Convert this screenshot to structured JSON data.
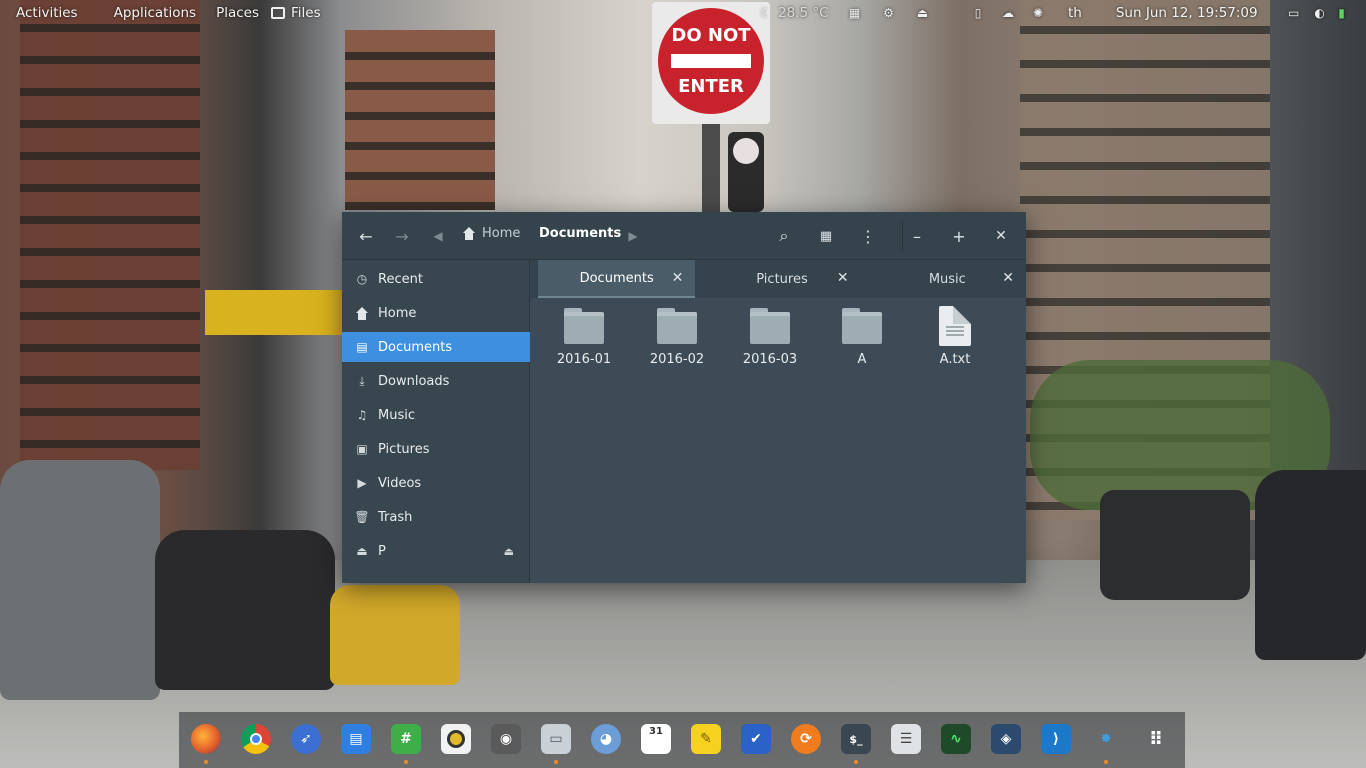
{
  "top_panel": {
    "activities": "Activities",
    "applications": "Applications",
    "places": "Places",
    "files": "Files",
    "weather": "28.5 °C",
    "lang": "th",
    "datetime": "Sun Jun 12, 19:57:09"
  },
  "wallpaper": {
    "sign_top": "DO NOT",
    "sign_bottom": "ENTER"
  },
  "window": {
    "breadcrumb_home": "Home",
    "breadcrumb_current": "Documents",
    "minimize": "–",
    "maximize": "+",
    "close": "✕"
  },
  "sidebar": {
    "items": [
      {
        "label": "Recent",
        "icon": "clock-icon"
      },
      {
        "label": "Home",
        "icon": "home-icon"
      },
      {
        "label": "Documents",
        "icon": "document-icon"
      },
      {
        "label": "Downloads",
        "icon": "download-icon"
      },
      {
        "label": "Music",
        "icon": "music-icon"
      },
      {
        "label": "Pictures",
        "icon": "picture-icon"
      },
      {
        "label": "Videos",
        "icon": "video-icon"
      },
      {
        "label": "Trash",
        "icon": "trash-icon"
      },
      {
        "label": "P",
        "icon": "drive-icon"
      }
    ],
    "selected": "Documents"
  },
  "tabs": [
    {
      "label": "Documents",
      "active": true
    },
    {
      "label": "Pictures",
      "active": false
    },
    {
      "label": "Music",
      "active": false
    }
  ],
  "files": [
    {
      "name": "2016-01",
      "type": "folder"
    },
    {
      "name": "2016-02",
      "type": "folder"
    },
    {
      "name": "2016-03",
      "type": "folder"
    },
    {
      "name": "A",
      "type": "folder"
    },
    {
      "name": "A.txt",
      "type": "text"
    }
  ],
  "dock": {
    "apps": [
      "firefox",
      "chrome",
      "safari-compass",
      "messaging",
      "spreadsheet",
      "rhythmbox",
      "camera",
      "files",
      "pidgin",
      "calendar",
      "sticky-notes",
      "tasks",
      "updater",
      "terminal",
      "settings",
      "system-monitor",
      "mysql-workbench",
      "vscode",
      "pycharm",
      "app-grid"
    ],
    "calendar_day": "31"
  },
  "colors": {
    "accent": "#3d8fe0",
    "window_bg": "#3c4b55",
    "headerbar": "#34434c",
    "sidebar": "#38464f"
  }
}
